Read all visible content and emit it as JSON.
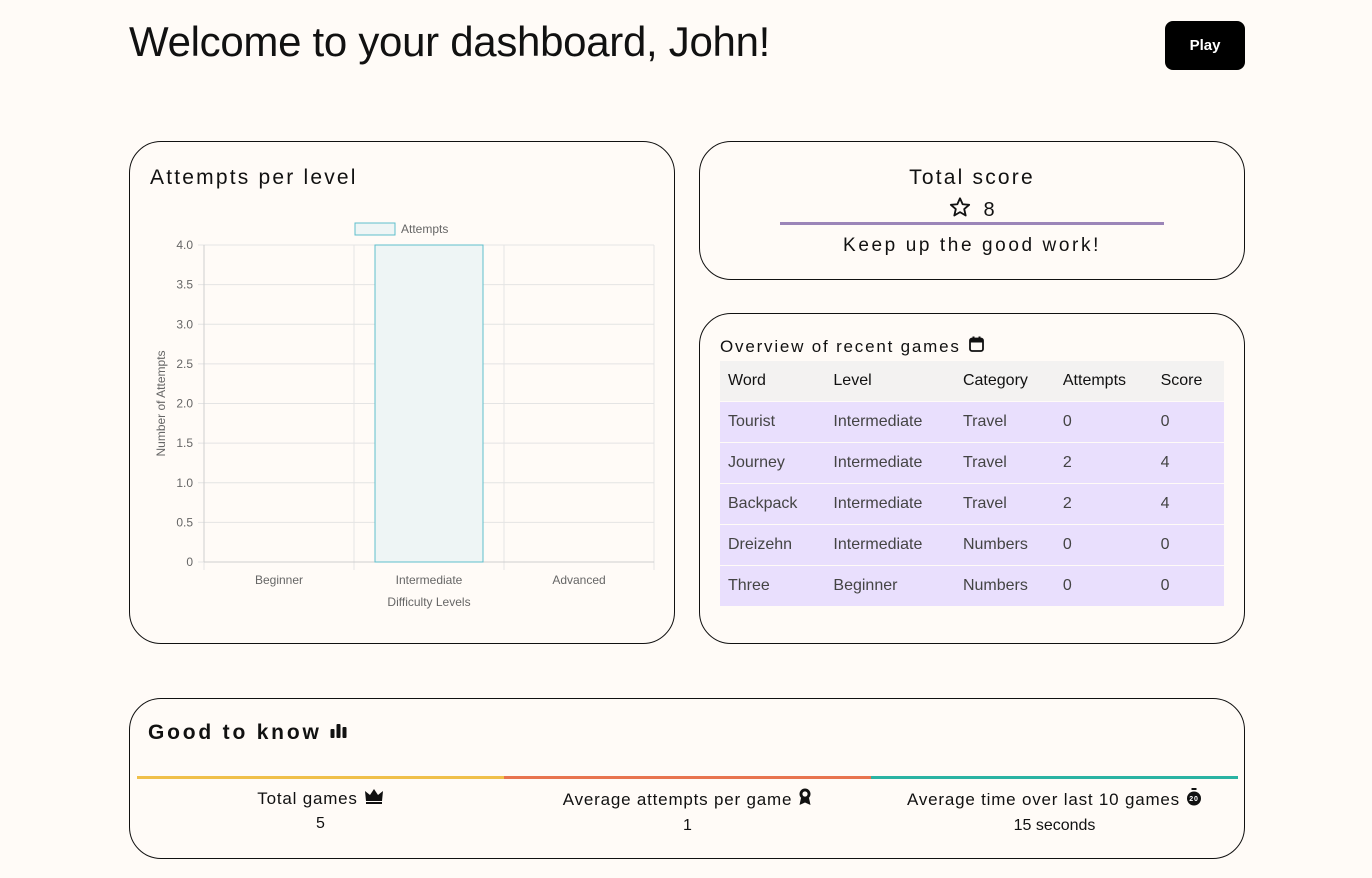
{
  "header": {
    "title": "Welcome to your dashboard, John!",
    "play_label": "Play"
  },
  "attempts_card": {
    "title": "Attempts per level"
  },
  "chart_data": {
    "type": "bar",
    "title": "",
    "categories": [
      "Beginner",
      "Intermediate",
      "Advanced"
    ],
    "series": [
      {
        "name": "Attempts",
        "values": [
          0,
          4,
          0
        ]
      }
    ],
    "xlabel": "Difficulty Levels",
    "ylabel": "Number of Attempts",
    "ylim": [
      0,
      4
    ],
    "yticks": [
      "0",
      "0.5",
      "1.0",
      "1.5",
      "2.0",
      "2.5",
      "3.0",
      "3.5",
      "4.0"
    ],
    "grid": true,
    "legend_position": "top",
    "bar_fill": "#eef5f5",
    "bar_stroke": "#5fbfcc"
  },
  "score_card": {
    "title": "Total score",
    "score": "8",
    "message": "Keep up the good work!",
    "accent": "#9b85b8"
  },
  "recent_games": {
    "title": "Overview of recent games",
    "columns": [
      "Word",
      "Level",
      "Category",
      "Attempts",
      "Score"
    ],
    "rows": [
      [
        "Tourist",
        "Intermediate",
        "Travel",
        "0",
        "0"
      ],
      [
        "Journey",
        "Intermediate",
        "Travel",
        "2",
        "4"
      ],
      [
        "Backpack",
        "Intermediate",
        "Travel",
        "2",
        "4"
      ],
      [
        "Dreizehn",
        "Intermediate",
        "Numbers",
        "0",
        "0"
      ],
      [
        "Three",
        "Beginner",
        "Numbers",
        "0",
        "0"
      ]
    ]
  },
  "good_to_know": {
    "title": "Good to know",
    "stats": [
      {
        "label": "Total games",
        "value": "5",
        "icon": "crown-icon",
        "color": "#f0c04a"
      },
      {
        "label": "Average attempts per game",
        "value": "1",
        "icon": "award-icon",
        "color": "#e8744f"
      },
      {
        "label": "Average time over last 10 games",
        "value": "15 seconds",
        "icon": "stopwatch-icon",
        "color": "#2ab3a3"
      }
    ]
  }
}
